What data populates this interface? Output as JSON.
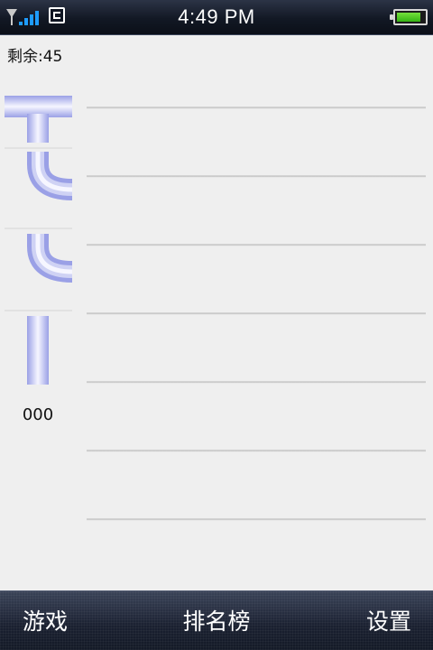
{
  "status_bar": {
    "time": "4:49 PM",
    "signal_bars": 4,
    "network_type_icon": "G",
    "battery_level": 0.85,
    "signal_color": "#1e9cff",
    "battery_color": "#4cc820"
  },
  "game": {
    "remaining_label": "剩余:45",
    "score": "000",
    "queue_pieces": [
      {
        "type": "t-junction",
        "icon": "pipe-t-icon"
      },
      {
        "type": "elbow",
        "icon": "pipe-elbow-icon"
      },
      {
        "type": "elbow",
        "icon": "pipe-elbow-icon"
      },
      {
        "type": "vertical-straight",
        "icon": "pipe-straight-icon"
      }
    ],
    "pipe_color": "#9aa0e6",
    "board_rows": 7
  },
  "tab_bar": {
    "tabs": [
      {
        "label": "游戏"
      },
      {
        "label": "排名榜"
      },
      {
        "label": "设置"
      }
    ]
  }
}
